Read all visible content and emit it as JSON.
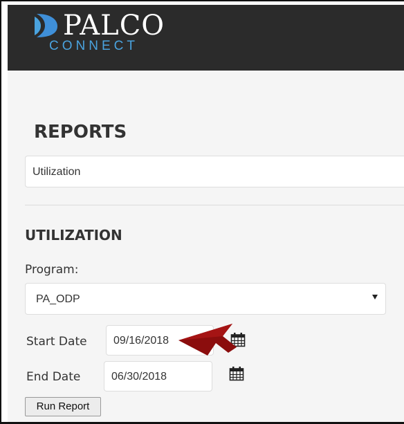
{
  "header": {
    "logo_word": "PALCO",
    "logo_sub": "CONNECT"
  },
  "reports": {
    "title": "REPORTS",
    "selected_report": "Utilization"
  },
  "utilization": {
    "title": "UTILIZATION",
    "program_label": "Program:",
    "program_value": "PA_ODP",
    "start_date_label": "Start Date",
    "start_date_value": "09/16/2018",
    "end_date_label": "End Date",
    "end_date_value": "06/30/2018",
    "run_button": "Run Report"
  },
  "colors": {
    "header_bg": "#2b2b2b",
    "brand_blue": "#4aa3df",
    "panel_bg": "#f5f5f5",
    "annotation_arrow": "#8b0d0d"
  },
  "icons": {
    "logo": "palco-logo-icon",
    "calendar": "calendar-icon",
    "select_caret": "caret-down-icon",
    "annotation": "red-arrow-annotation"
  }
}
